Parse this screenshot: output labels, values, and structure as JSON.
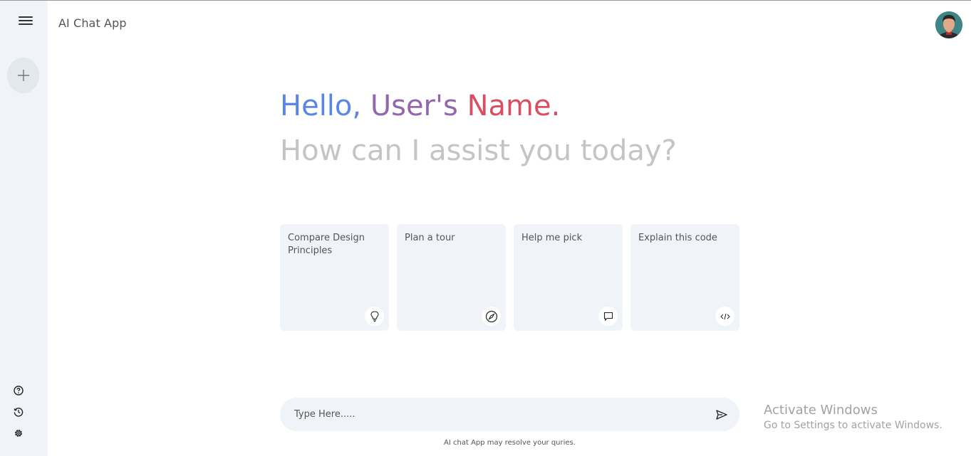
{
  "app": {
    "title": "AI Chat App"
  },
  "sidebar": {
    "menu_icon": "hamburger-menu-icon",
    "new_chat_icon": "plus-icon",
    "bottom_icons": [
      "help-circle-icon",
      "history-icon",
      "gear-icon"
    ]
  },
  "greeting": {
    "hello": "Hello, ",
    "user_part1": "User's ",
    "user_part2": "Name.",
    "prompt": "How can I assist you today?"
  },
  "cards": [
    {
      "label": "Compare Design Principles",
      "icon": "lightbulb-icon"
    },
    {
      "label": "Plan a tour",
      "icon": "compass-icon"
    },
    {
      "label": "Help me pick",
      "icon": "chat-bubble-icon"
    },
    {
      "label": "Explain this code",
      "icon": "code-icon"
    }
  ],
  "input": {
    "placeholder": "Type Here.....",
    "send_icon": "send-icon"
  },
  "disclaimer": "AI chat App may resolve your quries.",
  "watermark": {
    "line1": "Activate Windows",
    "line2": "Go to Settings to activate Windows."
  },
  "colors": {
    "sidebar_bg": "#f0f3f8",
    "greeting_blue": "#5a86e8",
    "greeting_purple": "#9367ad",
    "greeting_red": "#d84f62",
    "prompt_gray": "#c4c4c4"
  }
}
